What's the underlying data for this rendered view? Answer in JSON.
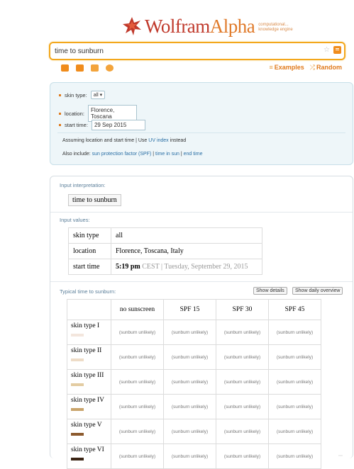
{
  "header": {
    "logo_word1": "Wolfram",
    "logo_word2": "Alpha",
    "logo_tagline_line1": "computational...",
    "logo_tagline_line2": "knowledge engine",
    "brand_color": "#c0392b",
    "accent_color": "#f3a71c"
  },
  "search": {
    "query": "time to sunburn",
    "favorite_icon": "star-icon",
    "submit_icon": "equals-icon"
  },
  "nav": {
    "examples_label": "Examples",
    "random_label": "Random"
  },
  "assumptions": {
    "skin_type_label": "skin type:",
    "skin_type_value": "all",
    "location_label": "location:",
    "location_value": "Florence, Toscana",
    "start_time_label": "start time:",
    "start_time_value": "29 Sep 2015",
    "note1_prefix": "Assuming location and start time  |  Use",
    "note1_link": "UV index",
    "note1_suffix": "instead",
    "note2_prefix": "Also include:",
    "note2_link1": "sun protection factor (SPF)",
    "note2_link2": "time in sun",
    "note2_link3": "end time"
  },
  "pods": {
    "interp_title": "Input interpretation:",
    "interp_value": "time to sunburn",
    "values_title": "Input values:",
    "values": {
      "skin_type_key": "skin type",
      "skin_type_val": "all",
      "location_key": "location",
      "location_val": "Florence, Toscana, Italy",
      "start_time_key": "start time",
      "time_main": "5:19 pm",
      "time_tz": "CEST",
      "time_sep": "|",
      "time_date": "Tuesday, September 29, 2015"
    },
    "sunburn_title": "Typical time to sunburn:",
    "show_details": "Show details",
    "show_daily": "Show daily overview"
  },
  "sunburn_table": {
    "headers": [
      "no sunscreen",
      "SPF 15",
      "SPF 30",
      "SPF 45"
    ],
    "cell": "(sunburn unlikely)",
    "rows": [
      {
        "label": "skin type I",
        "color": "#f3e6dd"
      },
      {
        "label": "skin type II",
        "color": "#eedcc7"
      },
      {
        "label": "skin type III",
        "color": "#e3cca2"
      },
      {
        "label": "skin type IV",
        "color": "#c9a46b"
      },
      {
        "label": "skin type V",
        "color": "#8c5a2e"
      },
      {
        "label": "skin type VI",
        "color": "#3a2414"
      }
    ]
  }
}
